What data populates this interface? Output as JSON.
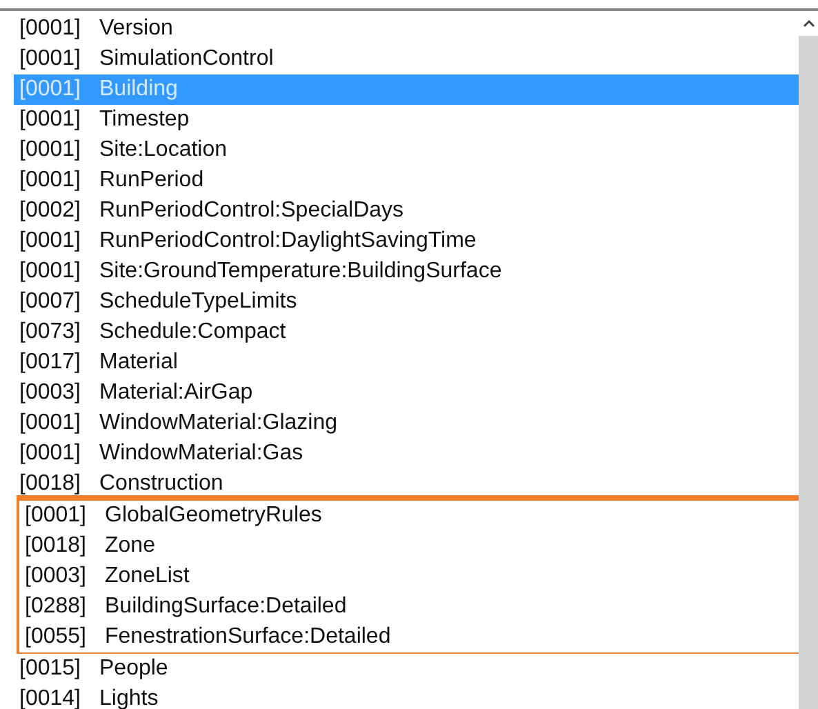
{
  "list": {
    "items": [
      {
        "count": "[0001]",
        "name": "Version",
        "selected": false,
        "highlighted": false
      },
      {
        "count": "[0001]",
        "name": "SimulationControl",
        "selected": false,
        "highlighted": false
      },
      {
        "count": "[0001]",
        "name": "Building",
        "selected": true,
        "highlighted": false
      },
      {
        "count": "[0001]",
        "name": "Timestep",
        "selected": false,
        "highlighted": false
      },
      {
        "count": "[0001]",
        "name": "Site:Location",
        "selected": false,
        "highlighted": false
      },
      {
        "count": "[0001]",
        "name": "RunPeriod",
        "selected": false,
        "highlighted": false
      },
      {
        "count": "[0002]",
        "name": "RunPeriodControl:SpecialDays",
        "selected": false,
        "highlighted": false
      },
      {
        "count": "[0001]",
        "name": "RunPeriodControl:DaylightSavingTime",
        "selected": false,
        "highlighted": false
      },
      {
        "count": "[0001]",
        "name": "Site:GroundTemperature:BuildingSurface",
        "selected": false,
        "highlighted": false
      },
      {
        "count": "[0007]",
        "name": "ScheduleTypeLimits",
        "selected": false,
        "highlighted": false
      },
      {
        "count": "[0073]",
        "name": "Schedule:Compact",
        "selected": false,
        "highlighted": false
      },
      {
        "count": "[0017]",
        "name": "Material",
        "selected": false,
        "highlighted": false
      },
      {
        "count": "[0003]",
        "name": "Material:AirGap",
        "selected": false,
        "highlighted": false
      },
      {
        "count": "[0001]",
        "name": "WindowMaterial:Glazing",
        "selected": false,
        "highlighted": false
      },
      {
        "count": "[0001]",
        "name": "WindowMaterial:Gas",
        "selected": false,
        "highlighted": false
      },
      {
        "count": "[0018]",
        "name": "Construction",
        "selected": false,
        "highlighted": false
      },
      {
        "count": "[0001]",
        "name": "GlobalGeometryRules",
        "selected": false,
        "highlighted": true
      },
      {
        "count": "[0018]",
        "name": "Zone",
        "selected": false,
        "highlighted": true
      },
      {
        "count": "[0003]",
        "name": "ZoneList",
        "selected": false,
        "highlighted": true
      },
      {
        "count": "[0288]",
        "name": "BuildingSurface:Detailed",
        "selected": false,
        "highlighted": true
      },
      {
        "count": "[0055]",
        "name": "FenestrationSurface:Detailed",
        "selected": false,
        "highlighted": true
      },
      {
        "count": "[0015]",
        "name": "People",
        "selected": false,
        "highlighted": false
      },
      {
        "count": "[0014]",
        "name": "Lights",
        "selected": false,
        "highlighted": false
      }
    ]
  }
}
